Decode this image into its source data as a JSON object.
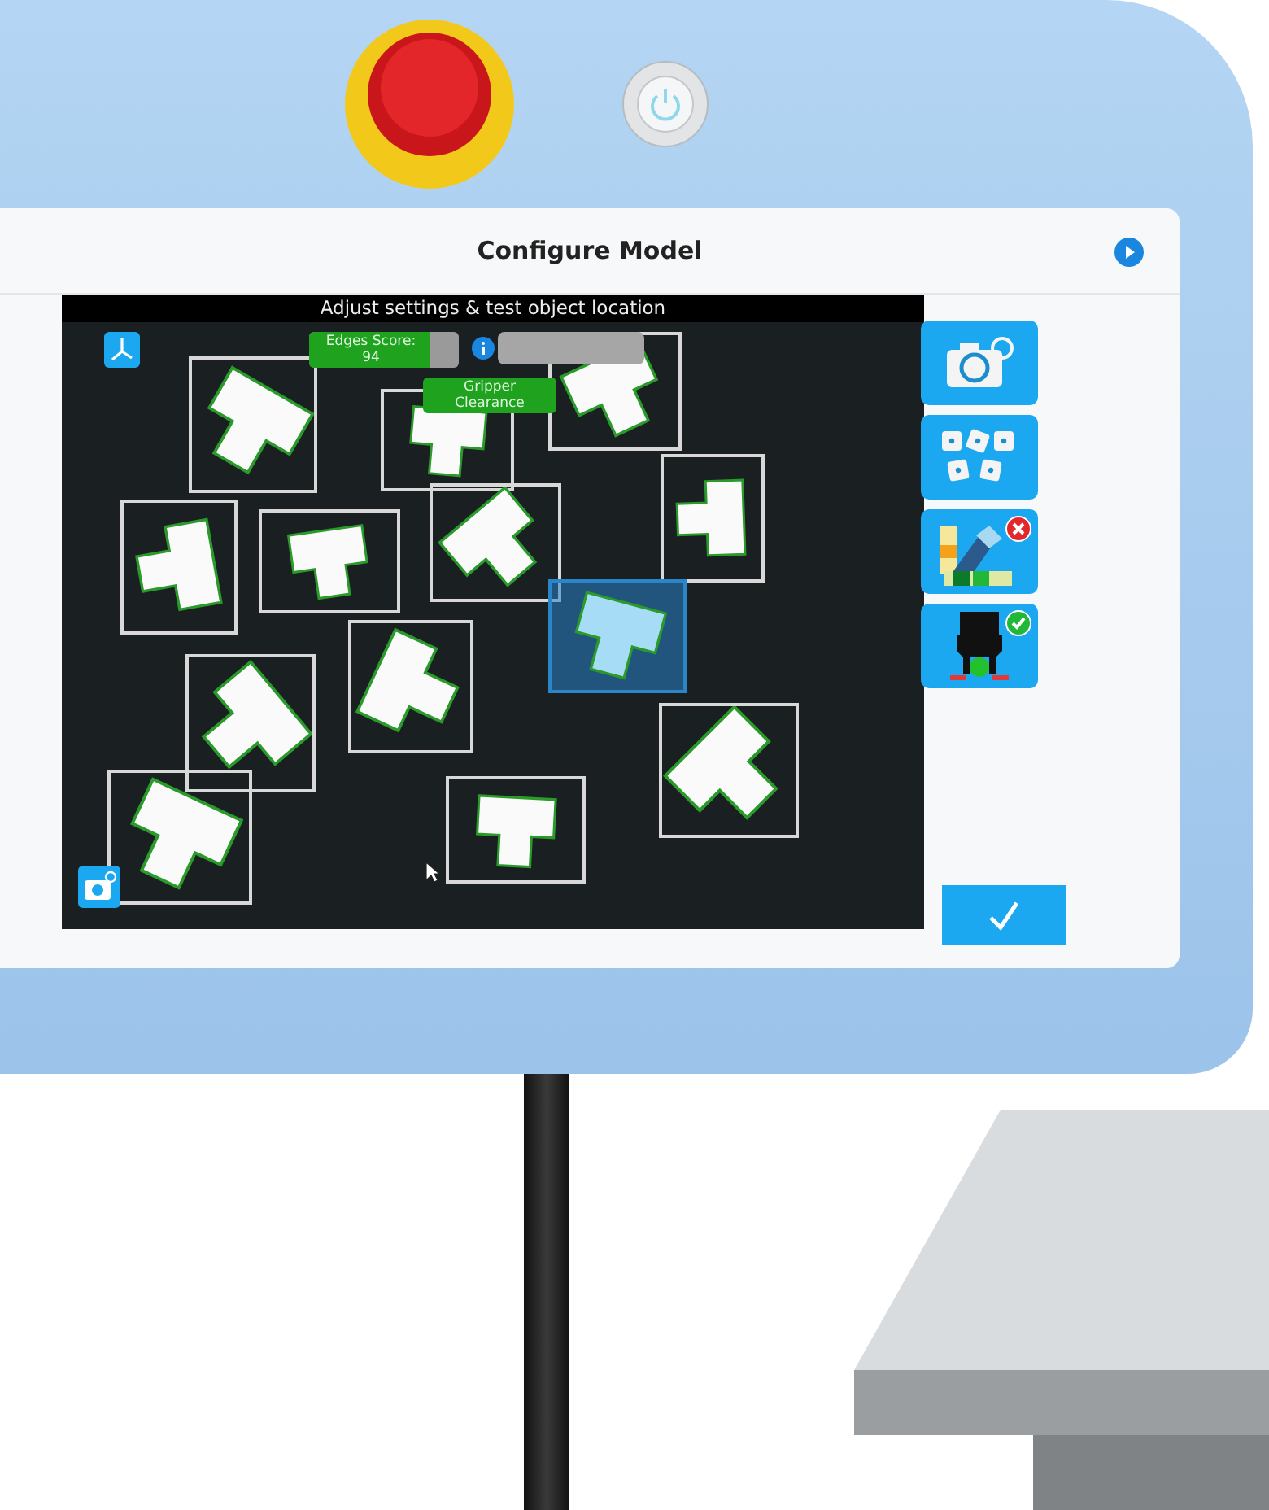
{
  "screen": {
    "title": "Configure Model",
    "camera_view": {
      "title": "Adjust settings & test object location",
      "edges_score": {
        "label": "Edges Score:",
        "value": "94",
        "level": 0.8
      },
      "gripper_clearance": {
        "label": "Gripper Clearance"
      },
      "detections": [
        {
          "selected": false
        },
        {
          "selected": false
        },
        {
          "selected": false
        },
        {
          "selected": false
        },
        {
          "selected": false
        },
        {
          "selected": false
        },
        {
          "selected": false
        },
        {
          "selected": true
        },
        {
          "selected": false
        },
        {
          "selected": false
        },
        {
          "selected": false
        },
        {
          "selected": false
        },
        {
          "selected": false
        }
      ]
    },
    "tools": [
      {
        "error": false,
        "checked": false
      },
      {
        "error": false,
        "checked": false
      },
      {
        "error": true,
        "checked": false
      },
      {
        "error": false,
        "checked": true
      }
    ]
  }
}
